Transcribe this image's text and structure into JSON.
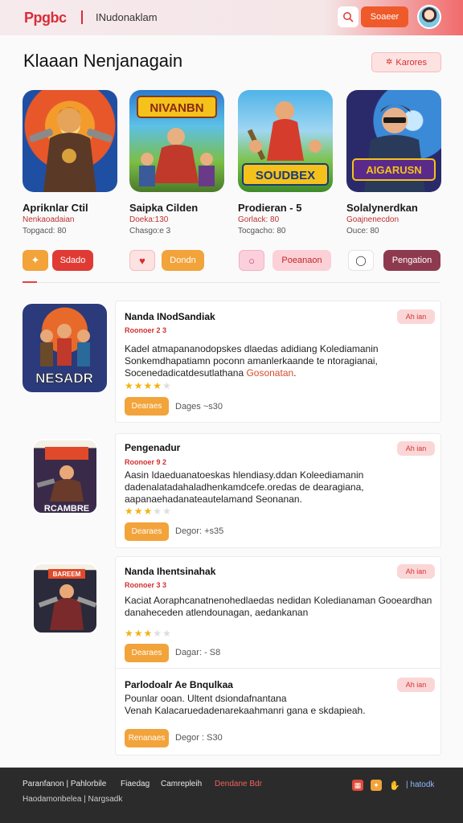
{
  "header": {
    "logo": "Ppgbc",
    "nav_title": "INudonaklam",
    "primary_button": "Soaeer",
    "search_icon": "search-icon",
    "avatar_icon": "avatar"
  },
  "section": {
    "title": "Klaaan Nenjanagain",
    "more_button": "Karores"
  },
  "cards": [
    {
      "name": "Apriknlar Ctil",
      "sub": "Nenkaoadaian",
      "meta": "Topgacd: 80",
      "action_label": "Sdado",
      "icon": "puzzle-icon"
    },
    {
      "name": "Saipka Cilden",
      "sub": "Doeka:130",
      "meta": "Chasgo:e 3",
      "action_label": "Dondn",
      "icon": "heart-icon"
    },
    {
      "name": "Prodieran - 5",
      "sub": "Gorlack: 80",
      "meta": "Tocgacho: 80",
      "action_label": "Poeanaon",
      "icon": "chat-icon"
    },
    {
      "name": "Solalynerdkan",
      "sub": "Goajnenecdon",
      "meta": "Ouce: 80",
      "action_label": "Pengation",
      "icon": "o-icon"
    }
  ],
  "card_art": [
    "",
    "NIVANBN",
    "SOUDBEX",
    "AIGARUSN"
  ],
  "list": [
    {
      "art": "NESADR",
      "title": "Nanda INodSandiak",
      "sub": "Roonoer 2 3",
      "desc_a": "Kadel atmapananodopskes dlaedas adidiang Kolediamanin Sonkemdhapatiamn poconn amanlerkaande te ntoragianai,",
      "desc_b": "Socenedadicatdesutlathana ",
      "desc_hl": "Gosonatan",
      "desc_c": ".",
      "rating": 4,
      "button": "Dearaes",
      "meta": "Dages ~s30",
      "tag": "Ah ian"
    },
    {
      "art": "RCAMBRE",
      "title": "Pengenadur",
      "sub": "Roonoer 9 2",
      "desc_a": "Aasin Idaeduanatoeskas hlendiasy.ddan Koleediamanin",
      "desc_b": "dadenalatadahaladhenkamdcefe.oredas de dearagiana,",
      "desc_hl": "",
      "desc_c": "aapanaehadanateautelamand Seonanan.",
      "rating": 3,
      "button": "Dearaes",
      "meta": "Degor: +s35",
      "tag": "Ah ian"
    },
    {
      "art": "BAREEM",
      "title": "Nanda Ihentsinahak",
      "sub": "Roonoer 3 3",
      "desc_a": "Kaciat Aoraphcanatnenohedlaedas nedidan Koledianaman Gooeardhan danaheceden atlendounagan,",
      "desc_b": "aedankanan",
      "desc_hl": "",
      "desc_c": "",
      "rating": 3,
      "button": "Dearaes",
      "meta": "Dagar: - S8",
      "tag": "Ah ian"
    },
    {
      "art": "",
      "title": "Parlodoalr Ae Bnqulkaa",
      "sub": "",
      "desc_a": "Pounlar ooan. Ultent dsiondafnantana",
      "desc_b": "Venah Kalacaruedadenarekaahmanri gana e skdapieah.",
      "desc_hl": "",
      "desc_c": "",
      "rating": 0,
      "button": "Renanaes",
      "meta": "Degor : S30",
      "tag": "Ah ian"
    }
  ],
  "footer": {
    "links_row1": [
      "Paranfanon | Pahlorbile",
      "Fiaedag",
      "Camrepleih",
      "Dendane Bdr"
    ],
    "links_row2": "Haodamonbelea | Nargsadk",
    "right_label": "| hatodk",
    "icons": [
      "grid-icon",
      "puzzle-icon",
      "hand-icon"
    ]
  },
  "colors": {
    "accent": "#ef5a2a",
    "danger": "#d92d3a",
    "warning": "#f2a33a",
    "footer_bg": "#2b2b2b"
  }
}
